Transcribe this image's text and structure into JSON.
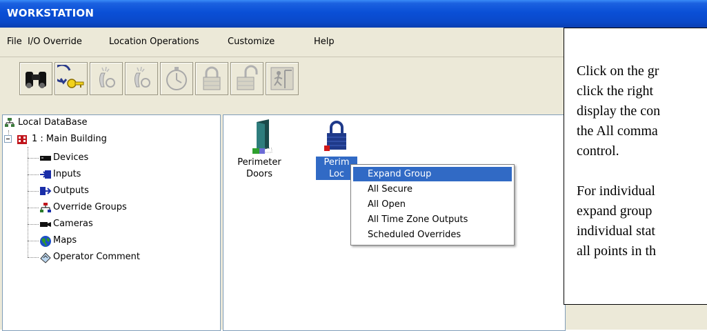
{
  "window": {
    "title": "WORKSTATION"
  },
  "menu": {
    "items": [
      "File",
      "I/O Override",
      "Location Operations",
      "Customize",
      "Help"
    ]
  },
  "toolbar": {
    "buttons": [
      {
        "icon": "binoculars-icon",
        "enabled": true
      },
      {
        "icon": "key-icon",
        "enabled": true
      },
      {
        "icon": "alarm-device-icon",
        "enabled": false
      },
      {
        "icon": "alarm-device-icon",
        "enabled": false
      },
      {
        "icon": "timer-icon",
        "enabled": false
      },
      {
        "icon": "lock-closed-icon",
        "enabled": false
      },
      {
        "icon": "lock-open-icon",
        "enabled": false
      },
      {
        "icon": "exit-icon",
        "enabled": false
      }
    ]
  },
  "tree": {
    "root": "Local DataBase",
    "building": "1 : Main Building",
    "children": [
      "Devices",
      "Inputs",
      "Outputs",
      "Override Groups",
      "Cameras",
      "Maps",
      "Operator Comment"
    ]
  },
  "groups": {
    "items": [
      {
        "label_line1": "Perimeter",
        "label_line2": "Doors"
      },
      {
        "label_line1": "Perim",
        "label_line2": "Loc"
      }
    ]
  },
  "context_menu": {
    "items": [
      "Expand Group",
      "All Secure",
      "All Open",
      "All Time Zone Outputs",
      "Scheduled Overrides"
    ],
    "selected": "Expand Group"
  },
  "callout": {
    "lines": [
      "Click on the gr",
      "click the right",
      "display the con",
      "the All comma",
      "control.",
      "",
      "For individual",
      "expand group",
      "individual stat",
      "all points in th"
    ]
  },
  "colors": {
    "titlebar": "#0a4fd6",
    "selection": "#316ac5",
    "face": "#ece9d8"
  }
}
